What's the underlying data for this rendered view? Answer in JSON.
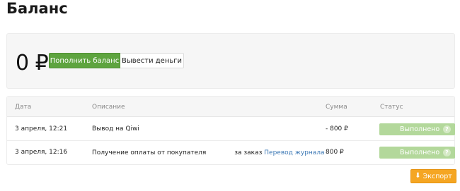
{
  "page": {
    "title": "Баланс"
  },
  "balance": {
    "amount": "0 ₽",
    "topup_label": "Пополнить баланс",
    "withdraw_label": "Вывести деньги"
  },
  "table": {
    "headers": {
      "date": "Дата",
      "description": "Описание",
      "sum": "Сумма",
      "status": "Статус"
    },
    "rows": [
      {
        "date": "3 апреля, 12:21",
        "description": "Вывод на Qiwi",
        "sum": "- 800 ₽",
        "status": "Выполнено",
        "help": "?"
      },
      {
        "date": "3 апреля, 12:16",
        "description_prefix": "Получение оплаты от покупателя",
        "description_middle": "за заказ",
        "description_link": "Перевод журнала",
        "sum": "800 ₽",
        "status": "Выполнено",
        "help": "?"
      }
    ]
  },
  "export": {
    "label": "Экспорт",
    "icon": "download-icon"
  },
  "colors": {
    "primary_green": "#5ea43f",
    "status_green": "#b3d89b",
    "export_orange": "#f5a623",
    "link_blue": "#3c78b5"
  }
}
